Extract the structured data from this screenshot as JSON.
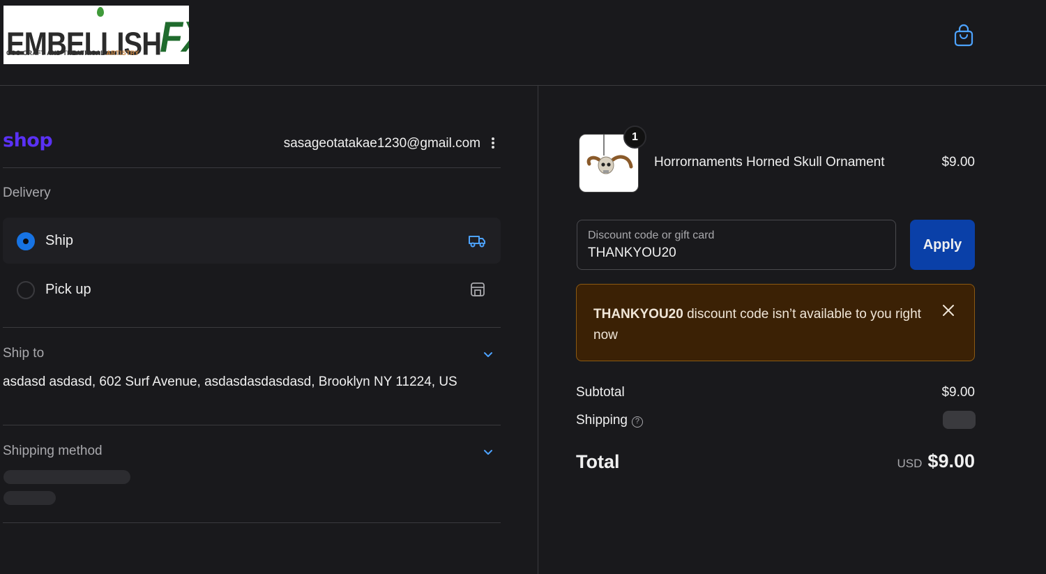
{
  "header": {
    "logo_main": "EMBELLISH",
    "logo_fx": "FX",
    "logo_sub_a": "COS-CRAFT AND THEATRICAL",
    "logo_sub_b": "ARTISTRY",
    "cart_icon": "shopping-bag-icon"
  },
  "account": {
    "brand": "shop",
    "email": "sasageotatakae1230@gmail.com",
    "menu_icon": "kebab-menu-icon"
  },
  "delivery": {
    "title": "Delivery",
    "options": [
      {
        "label": "Ship",
        "selected": true,
        "icon": "truck-icon"
      },
      {
        "label": "Pick up",
        "selected": false,
        "icon": "store-icon"
      }
    ]
  },
  "ship_to": {
    "title": "Ship to",
    "address": "asdasd asdasd, 602 Surf Avenue, asdasdasdasdasd, Brooklyn NY 11224, US"
  },
  "shipping_method": {
    "title": "Shipping method"
  },
  "order": {
    "item": {
      "quantity": "1",
      "name": "Horrornaments Horned Skull Ornament",
      "price": "$9.00"
    },
    "discount": {
      "placeholder": "Discount code or gift card",
      "value": "THANKYOU20",
      "apply_label": "Apply"
    },
    "alert": {
      "code": "THANKYOU20",
      "message": " discount code isn’t available to you right now"
    },
    "summary": {
      "subtotal_label": "Subtotal",
      "subtotal_value": "$9.00",
      "shipping_label": "Shipping",
      "total_label": "Total",
      "currency": "USD",
      "total_value": "$9.00"
    }
  },
  "colors": {
    "background": "#19191c",
    "shop_brand": "#5a31f4",
    "primary_button": "#0a40a8",
    "radio_selected": "#1773e3",
    "alert_bg": "#3b2105",
    "alert_border": "#8c5a12"
  }
}
